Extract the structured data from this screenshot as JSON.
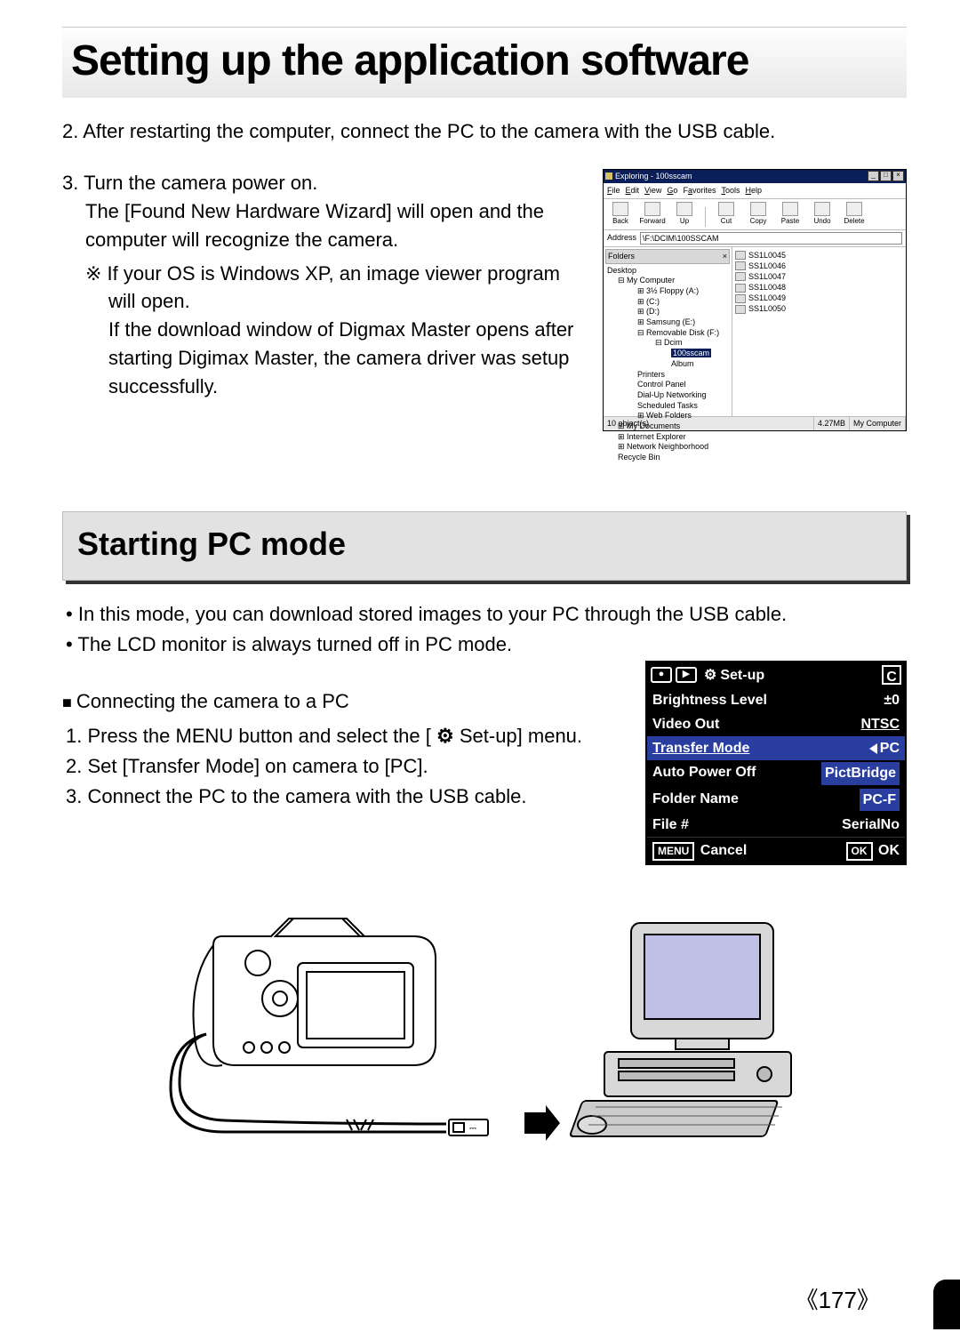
{
  "title": "Setting up the application software",
  "step2": "2. After restarting the computer, connect the PC to the camera with the USB cable.",
  "step3_l1": "3. Turn the camera power on.",
  "step3_l2": "The [Found New Hardware Wizard] will open and the computer will recognize the camera.",
  "note_l1": "If your OS is Windows XP, an image viewer program will open.",
  "note_l2": "If the download window of Digmax Master opens after starting Digimax Master, the camera driver was setup successfully.",
  "explorer": {
    "title": "Exploring - 100sscam",
    "menu": [
      "File",
      "Edit",
      "View",
      "Go",
      "Favorites",
      "Tools",
      "Help"
    ],
    "toolbar": [
      "Back",
      "Forward",
      "Up",
      "Cut",
      "Copy",
      "Paste",
      "Undo",
      "Delete"
    ],
    "address_label": "Address",
    "address_value": "\\F:\\DCIM\\100SSCAM",
    "folders_label": "Folders",
    "tree": {
      "root": "Desktop",
      "items": [
        "My Computer",
        "3½ Floppy (A:)",
        "(C:)",
        "(D:)",
        "Samsung (E:)",
        "Removable Disk (F:)",
        "Dcim",
        "100sscam",
        "Album",
        "Printers",
        "Control Panel",
        "Dial-Up Networking",
        "Scheduled Tasks",
        "Web Folders",
        "My Documents",
        "Internet Explorer",
        "Network Neighborhood",
        "Recycle Bin"
      ],
      "selected": "100sscam"
    },
    "files": [
      "SS1L0045",
      "SS1L0046",
      "SS1L0047",
      "SS1L0048",
      "SS1L0049",
      "SS1L0050"
    ],
    "status_left": "10 object(s)",
    "status_mid": "4.27MB",
    "status_right": "My Computer"
  },
  "section2": "Starting PC mode",
  "s2_b1": "In this mode, you can download stored images to your PC through the USB cable.",
  "s2_b2": "The LCD monitor is always turned off in PC mode.",
  "s2_head": "Connecting the camera to a PC",
  "s2_step1_a": "1. Press the MENU button and select the [ ",
  "s2_step1_b": "  Set-up] menu.",
  "s2_step2": "2. Set [Transfer Mode] on camera to [PC].",
  "s2_step3": "3. Connect the PC to the camera with the USB cable.",
  "lcd": {
    "title": "Set-up",
    "badge": "C",
    "rows": [
      {
        "k": "Brightness Level",
        "v": "±0"
      },
      {
        "k": "Video Out",
        "v": "NTSC"
      },
      {
        "k": "Transfer Mode",
        "v": "PC",
        "sel": true
      },
      {
        "k": "Auto Power Off",
        "v": "PictBridge",
        "opt": true
      },
      {
        "k": "Folder Name",
        "v": "PC-F",
        "opt": true
      },
      {
        "k": "File #",
        "v": "SerialNo"
      }
    ],
    "cancel_btn": "MENU",
    "cancel_lbl": "Cancel",
    "ok_btn": "OK",
    "ok_lbl": "OK"
  },
  "pagenum": "177"
}
